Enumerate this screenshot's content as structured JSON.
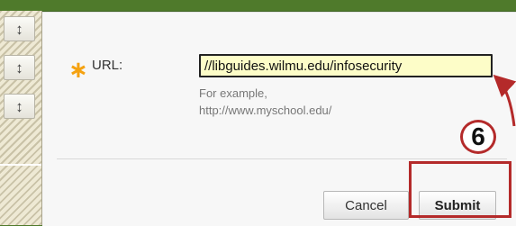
{
  "form": {
    "url_label": "URL:",
    "url_value": "//libguides.wilmu.edu/infosecurity",
    "example_line1": "For example,",
    "example_line2": "http://www.myschool.edu/",
    "required_mark": "∗"
  },
  "buttons": {
    "cancel": "Cancel",
    "submit": "Submit"
  },
  "annotation": {
    "step_number": "6",
    "color": "#b42a2a"
  },
  "drag_handles": [
    "↕",
    "↕",
    "↕"
  ],
  "icons": {
    "handle": "vertical-resize-arrows",
    "required": "asterisk"
  }
}
